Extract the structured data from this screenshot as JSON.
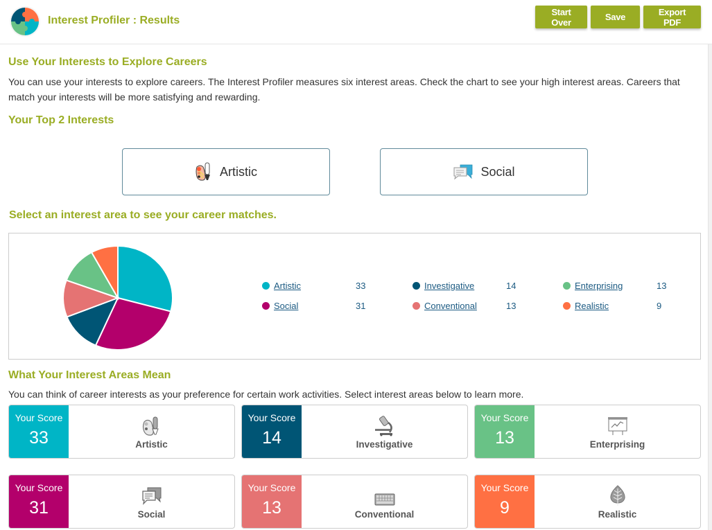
{
  "header": {
    "title": "Interest Profiler : Results",
    "buttons": {
      "start_over": "Start Over",
      "save": "Save",
      "export_pdf": "Export PDF"
    }
  },
  "intro": {
    "heading": "Use Your Interests to Explore Careers",
    "text": "You can use your interests to explore careers. The Interest Profiler measures six interest areas. Check the chart to see your high interest areas. Careers that match your interests will be more satisfying and rewarding."
  },
  "top_interests": {
    "heading": "Your Top 2 Interests",
    "items": [
      {
        "label": "Artistic",
        "icon": "palette-icon"
      },
      {
        "label": "Social",
        "icon": "chat-bubbles-icon"
      }
    ]
  },
  "select_heading": "Select an interest area to see your career matches.",
  "chart_data": {
    "type": "pie",
    "title": "",
    "slices": [
      {
        "label": "Artistic",
        "value": 33,
        "color": "#00b5c6"
      },
      {
        "label": "Social",
        "value": 31,
        "color": "#b3006b"
      },
      {
        "label": "Investigative",
        "value": 14,
        "color": "#005575"
      },
      {
        "label": "Conventional",
        "value": 13,
        "color": "#e57373"
      },
      {
        "label": "Enterprising",
        "value": 13,
        "color": "#69c286"
      },
      {
        "label": "Realistic",
        "value": 9,
        "color": "#ff7043"
      }
    ],
    "legend": [
      {
        "label": "Artistic",
        "value": "33",
        "color": "#00b5c6"
      },
      {
        "label": "Social",
        "value": "31",
        "color": "#b3006b"
      },
      {
        "label": "Investigative",
        "value": "14",
        "color": "#005575"
      },
      {
        "label": "Conventional",
        "value": "13",
        "color": "#e57373"
      },
      {
        "label": "Enterprising",
        "value": "13",
        "color": "#69c286"
      },
      {
        "label": "Realistic",
        "value": "9",
        "color": "#ff7043"
      }
    ],
    "legend_placement": "right"
  },
  "meaning": {
    "heading": "What Your Interest Areas Mean",
    "text": "You can think of career interests as your preference for certain work activities. Select interest areas below to learn more.",
    "score_label": "Your Score",
    "cards": [
      {
        "name": "Artistic",
        "score": "33",
        "color": "#00b5c6",
        "icon": "palette-icon"
      },
      {
        "name": "Investigative",
        "score": "14",
        "color": "#005575",
        "icon": "microscope-icon"
      },
      {
        "name": "Enterprising",
        "score": "13",
        "color": "#69c286",
        "icon": "presentation-chart-icon"
      },
      {
        "name": "Social",
        "score": "31",
        "color": "#b3006b",
        "icon": "chat-bubbles-icon"
      },
      {
        "name": "Conventional",
        "score": "13",
        "color": "#e57373",
        "icon": "keyboard-icon"
      },
      {
        "name": "Realistic",
        "score": "9",
        "color": "#ff7043",
        "icon": "leaf-icon"
      }
    ]
  }
}
